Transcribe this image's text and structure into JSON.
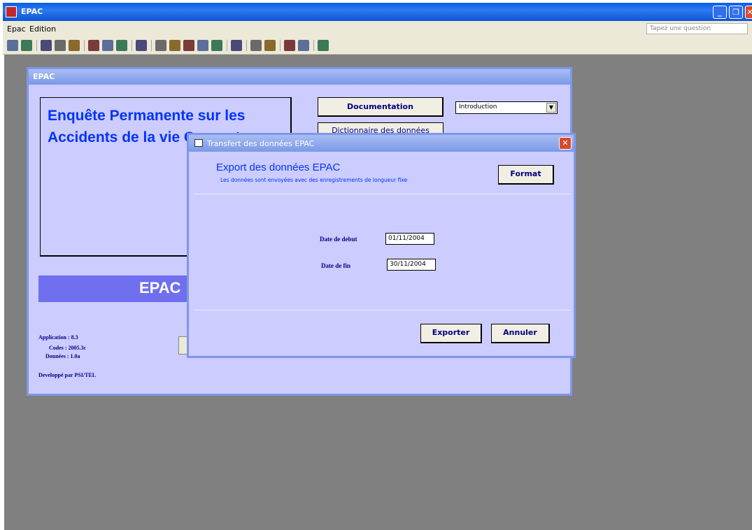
{
  "window": {
    "title": "EPAC",
    "minimize_label": "_",
    "maximize_label": "❐",
    "close_label": "✕"
  },
  "menu": {
    "items": [
      "Epac",
      "Edition"
    ],
    "ask_placeholder": "Tapez une question"
  },
  "toolbar": {
    "icons": [
      "save-icon",
      "database-icon",
      "print-icon",
      "print-preview-icon",
      "spelling-icon",
      "cut-icon",
      "copy-icon",
      "paste-icon",
      "undo-icon",
      "sort-ascending-icon",
      "sort-descending-icon",
      "filter-by-selection-icon",
      "filter-by-form-icon",
      "apply-filter-icon",
      "find-icon",
      "new-record-icon",
      "delete-record-icon",
      "database-window-icon",
      "new-object-icon",
      "help-icon"
    ]
  },
  "main_form": {
    "title": "EPAC",
    "heading": "Enquête Permanente sur les Accidents de la vie Courante",
    "banner": "EPAC",
    "documentation_button": "Documentation",
    "dictionary_button": "Dictionnaire des données",
    "intro_select_value": "Introduction",
    "info": {
      "application": "Application :  8.3",
      "codes": "Codes :  2005.3c",
      "donnees": "Données :  1.0a",
      "developed_by": "Developpé par PSI/TEL"
    }
  },
  "dialog": {
    "title": "Transfert des données EPAC",
    "close_label": "✕",
    "heading": "Export des données EPAC",
    "subtitle": "Les données sont envoyées avec des enregistrements de longueur fixe",
    "format_button": "Format",
    "date_debut_label": "Date de debut",
    "date_debut_value": "01/11/2004",
    "date_fin_label": "Date de fin",
    "date_fin_value": "30/11/2004",
    "export_button": "Exporter",
    "cancel_button": "Annuler"
  },
  "colors": {
    "titlebar": "#0a5ee5",
    "form_bg": "#ccccff",
    "accent_text": "#0033ff",
    "banner": "#6f6fef",
    "workspace": "#808080"
  }
}
